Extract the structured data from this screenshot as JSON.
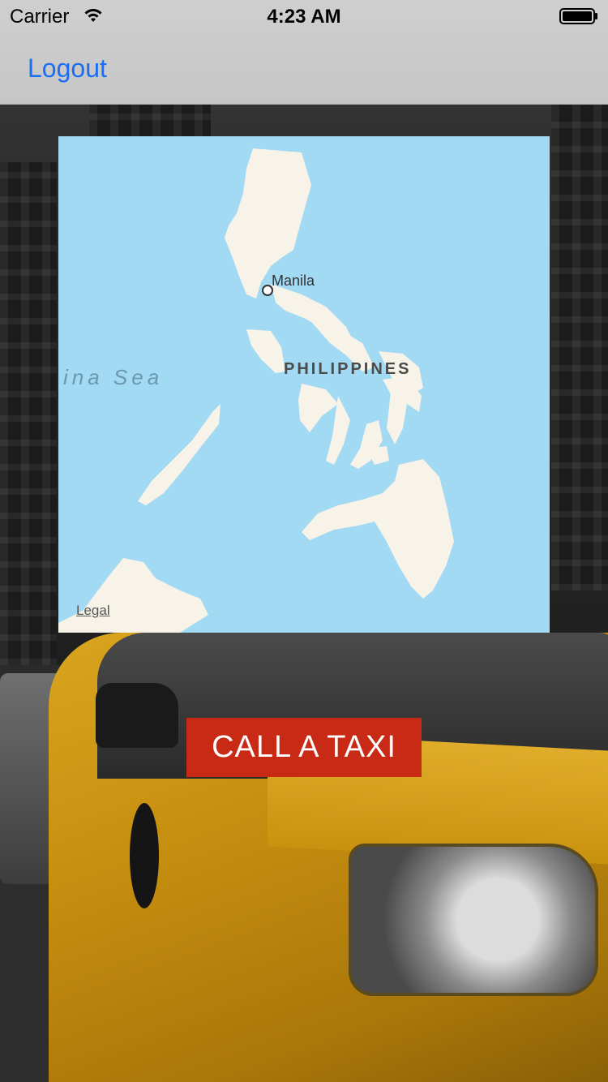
{
  "status_bar": {
    "carrier": "Carrier",
    "time": "4:23 AM",
    "wifi_icon": "wifi-icon",
    "battery_icon": "battery-full-icon"
  },
  "nav": {
    "logout_label": "Logout"
  },
  "map": {
    "sea_label": "ina Sea",
    "country_label": "PHILIPPINES",
    "city_label": "Manila",
    "legal_label": "Legal",
    "water_color": "#a2d9f3",
    "land_color": "#f7f3e9"
  },
  "actions": {
    "call_taxi_label": "CALL A TAXI",
    "call_taxi_color": "#c92a16"
  },
  "colors": {
    "accent": "#1a6ef5"
  }
}
